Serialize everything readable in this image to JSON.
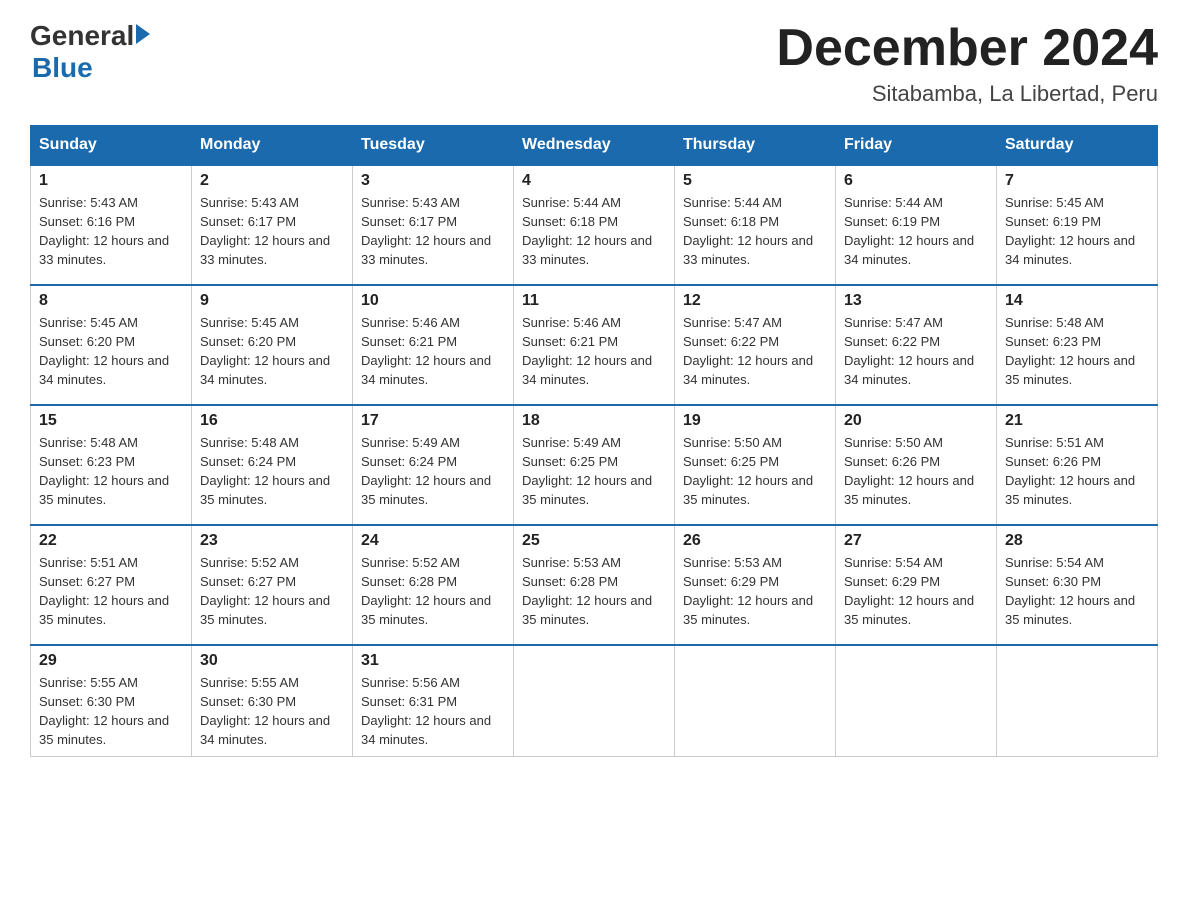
{
  "logo": {
    "text1": "General",
    "text2": "Blue"
  },
  "title": "December 2024",
  "subtitle": "Sitabamba, La Libertad, Peru",
  "days_header": [
    "Sunday",
    "Monday",
    "Tuesday",
    "Wednesday",
    "Thursday",
    "Friday",
    "Saturday"
  ],
  "weeks": [
    [
      {
        "num": "1",
        "sunrise": "5:43 AM",
        "sunset": "6:16 PM",
        "daylight": "12 hours and 33 minutes."
      },
      {
        "num": "2",
        "sunrise": "5:43 AM",
        "sunset": "6:17 PM",
        "daylight": "12 hours and 33 minutes."
      },
      {
        "num": "3",
        "sunrise": "5:43 AM",
        "sunset": "6:17 PM",
        "daylight": "12 hours and 33 minutes."
      },
      {
        "num": "4",
        "sunrise": "5:44 AM",
        "sunset": "6:18 PM",
        "daylight": "12 hours and 33 minutes."
      },
      {
        "num": "5",
        "sunrise": "5:44 AM",
        "sunset": "6:18 PM",
        "daylight": "12 hours and 33 minutes."
      },
      {
        "num": "6",
        "sunrise": "5:44 AM",
        "sunset": "6:19 PM",
        "daylight": "12 hours and 34 minutes."
      },
      {
        "num": "7",
        "sunrise": "5:45 AM",
        "sunset": "6:19 PM",
        "daylight": "12 hours and 34 minutes."
      }
    ],
    [
      {
        "num": "8",
        "sunrise": "5:45 AM",
        "sunset": "6:20 PM",
        "daylight": "12 hours and 34 minutes."
      },
      {
        "num": "9",
        "sunrise": "5:45 AM",
        "sunset": "6:20 PM",
        "daylight": "12 hours and 34 minutes."
      },
      {
        "num": "10",
        "sunrise": "5:46 AM",
        "sunset": "6:21 PM",
        "daylight": "12 hours and 34 minutes."
      },
      {
        "num": "11",
        "sunrise": "5:46 AM",
        "sunset": "6:21 PM",
        "daylight": "12 hours and 34 minutes."
      },
      {
        "num": "12",
        "sunrise": "5:47 AM",
        "sunset": "6:22 PM",
        "daylight": "12 hours and 34 minutes."
      },
      {
        "num": "13",
        "sunrise": "5:47 AM",
        "sunset": "6:22 PM",
        "daylight": "12 hours and 34 minutes."
      },
      {
        "num": "14",
        "sunrise": "5:48 AM",
        "sunset": "6:23 PM",
        "daylight": "12 hours and 35 minutes."
      }
    ],
    [
      {
        "num": "15",
        "sunrise": "5:48 AM",
        "sunset": "6:23 PM",
        "daylight": "12 hours and 35 minutes."
      },
      {
        "num": "16",
        "sunrise": "5:48 AM",
        "sunset": "6:24 PM",
        "daylight": "12 hours and 35 minutes."
      },
      {
        "num": "17",
        "sunrise": "5:49 AM",
        "sunset": "6:24 PM",
        "daylight": "12 hours and 35 minutes."
      },
      {
        "num": "18",
        "sunrise": "5:49 AM",
        "sunset": "6:25 PM",
        "daylight": "12 hours and 35 minutes."
      },
      {
        "num": "19",
        "sunrise": "5:50 AM",
        "sunset": "6:25 PM",
        "daylight": "12 hours and 35 minutes."
      },
      {
        "num": "20",
        "sunrise": "5:50 AM",
        "sunset": "6:26 PM",
        "daylight": "12 hours and 35 minutes."
      },
      {
        "num": "21",
        "sunrise": "5:51 AM",
        "sunset": "6:26 PM",
        "daylight": "12 hours and 35 minutes."
      }
    ],
    [
      {
        "num": "22",
        "sunrise": "5:51 AM",
        "sunset": "6:27 PM",
        "daylight": "12 hours and 35 minutes."
      },
      {
        "num": "23",
        "sunrise": "5:52 AM",
        "sunset": "6:27 PM",
        "daylight": "12 hours and 35 minutes."
      },
      {
        "num": "24",
        "sunrise": "5:52 AM",
        "sunset": "6:28 PM",
        "daylight": "12 hours and 35 minutes."
      },
      {
        "num": "25",
        "sunrise": "5:53 AM",
        "sunset": "6:28 PM",
        "daylight": "12 hours and 35 minutes."
      },
      {
        "num": "26",
        "sunrise": "5:53 AM",
        "sunset": "6:29 PM",
        "daylight": "12 hours and 35 minutes."
      },
      {
        "num": "27",
        "sunrise": "5:54 AM",
        "sunset": "6:29 PM",
        "daylight": "12 hours and 35 minutes."
      },
      {
        "num": "28",
        "sunrise": "5:54 AM",
        "sunset": "6:30 PM",
        "daylight": "12 hours and 35 minutes."
      }
    ],
    [
      {
        "num": "29",
        "sunrise": "5:55 AM",
        "sunset": "6:30 PM",
        "daylight": "12 hours and 35 minutes."
      },
      {
        "num": "30",
        "sunrise": "5:55 AM",
        "sunset": "6:30 PM",
        "daylight": "12 hours and 34 minutes."
      },
      {
        "num": "31",
        "sunrise": "5:56 AM",
        "sunset": "6:31 PM",
        "daylight": "12 hours and 34 minutes."
      },
      null,
      null,
      null,
      null
    ]
  ]
}
